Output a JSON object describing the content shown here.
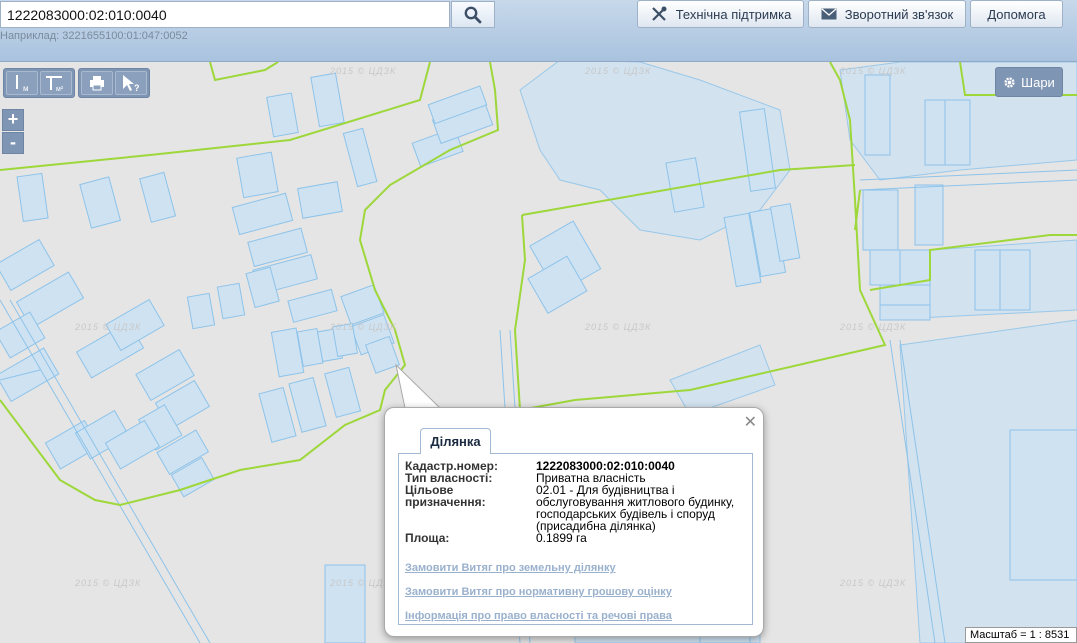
{
  "search": {
    "value": "1222083000:02:010:0040",
    "placeholder": "1222083000:02:010:0040",
    "hint": "Наприклад: 3221655100:01:047:0052"
  },
  "top_buttons": {
    "support": "Технічна підтримка",
    "feedback": "Зворотний зв'язок",
    "help": "Допомога"
  },
  "map_tools": {
    "layers": "Шари",
    "zoom_in": "+",
    "zoom_out": "-",
    "measure_length_sub": "м",
    "measure_area_sub": "м²",
    "info_sub": "?"
  },
  "watermark": "2015 © ЦДЗК",
  "scale": "Масштаб = 1 : 8531",
  "popup": {
    "tab": "Ділянка",
    "rows": [
      {
        "label": "Кадастр.номер:",
        "value": "1222083000:02:010:0040"
      },
      {
        "label": "Тип власності:",
        "value": "Приватна власність"
      },
      {
        "label": "Цільове призначення:",
        "value": "02.01 - Для будівництва і обслуговування житлового будинку, господарських будівель і споруд (присадибна ділянка)"
      },
      {
        "label": "Площа:",
        "value": "0.1899 га"
      }
    ],
    "links": [
      "Замовити Витяг про земельну ділянку",
      "Замовити Витяг про нормативну грошову оцінку",
      "Інформація про право власності та речові права"
    ]
  },
  "colors": {
    "parcel_fill": "#cfe2f1",
    "parcel_stroke": "#8dc3ea",
    "boundary": "#9dd73a",
    "toolbar": "#7f95b4"
  }
}
